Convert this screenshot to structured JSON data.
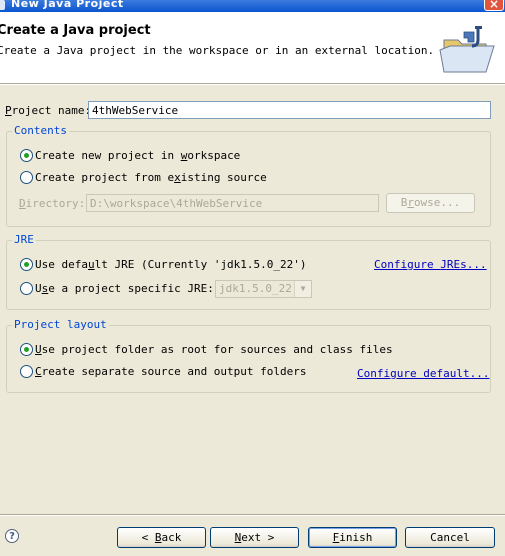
{
  "window": {
    "title": "New Java Project",
    "close_label": "×"
  },
  "banner": {
    "title": "Create a Java project",
    "description": "Create a Java project in the workspace or in an external location.",
    "icon": "new-java-project-folder-icon"
  },
  "project_name": {
    "label_mnemonic": "P",
    "label_rest": "roject name:",
    "value": "4thWebService"
  },
  "contents": {
    "legend": "Contents",
    "option_new_pre": "Create new project in ",
    "option_new_key": "w",
    "option_new_post": "orkspace",
    "option_existing_pre": "Create project from e",
    "option_existing_key": "x",
    "option_existing_post": "isting source",
    "directory_label_key": "D",
    "directory_label_rest": "irectory:",
    "directory_value": "D:\\workspace\\4thWebService",
    "browse_key": "r",
    "browse_pre": "B",
    "browse_post": "owse...",
    "selected": "new"
  },
  "jre": {
    "legend": "JRE",
    "default_pre": "Use defa",
    "default_key": "u",
    "default_post": "lt JRE (Currently 'jdk1.5.0_22')",
    "specific_pre": "U",
    "specific_key": "s",
    "specific_post": "e a project specific JRE:",
    "specific_value": "jdk1.5.0_22",
    "configure_pre": "Configure ",
    "configure_key": "J",
    "configure_post": "REs...",
    "selected": "default"
  },
  "project_layout": {
    "legend": "Project layout",
    "option_root_key": "U",
    "option_root_rest": "se project folder as root for sources and class files",
    "option_separate_key": "C",
    "option_separate_rest": "reate separate source and output folders",
    "configure_default": "Configure default...",
    "selected": "root"
  },
  "buttons": {
    "help": "?",
    "back_arrow": "<",
    "back_key": "B",
    "back_rest": "ack",
    "next_key": "N",
    "next_rest": "ext",
    "next_arrow": ">",
    "finish_key": "F",
    "finish_rest": "inish",
    "cancel": "Cancel"
  },
  "colors": {
    "accent": "#0046d5",
    "link": "#0000c0",
    "radio_dot": "#21a121"
  }
}
